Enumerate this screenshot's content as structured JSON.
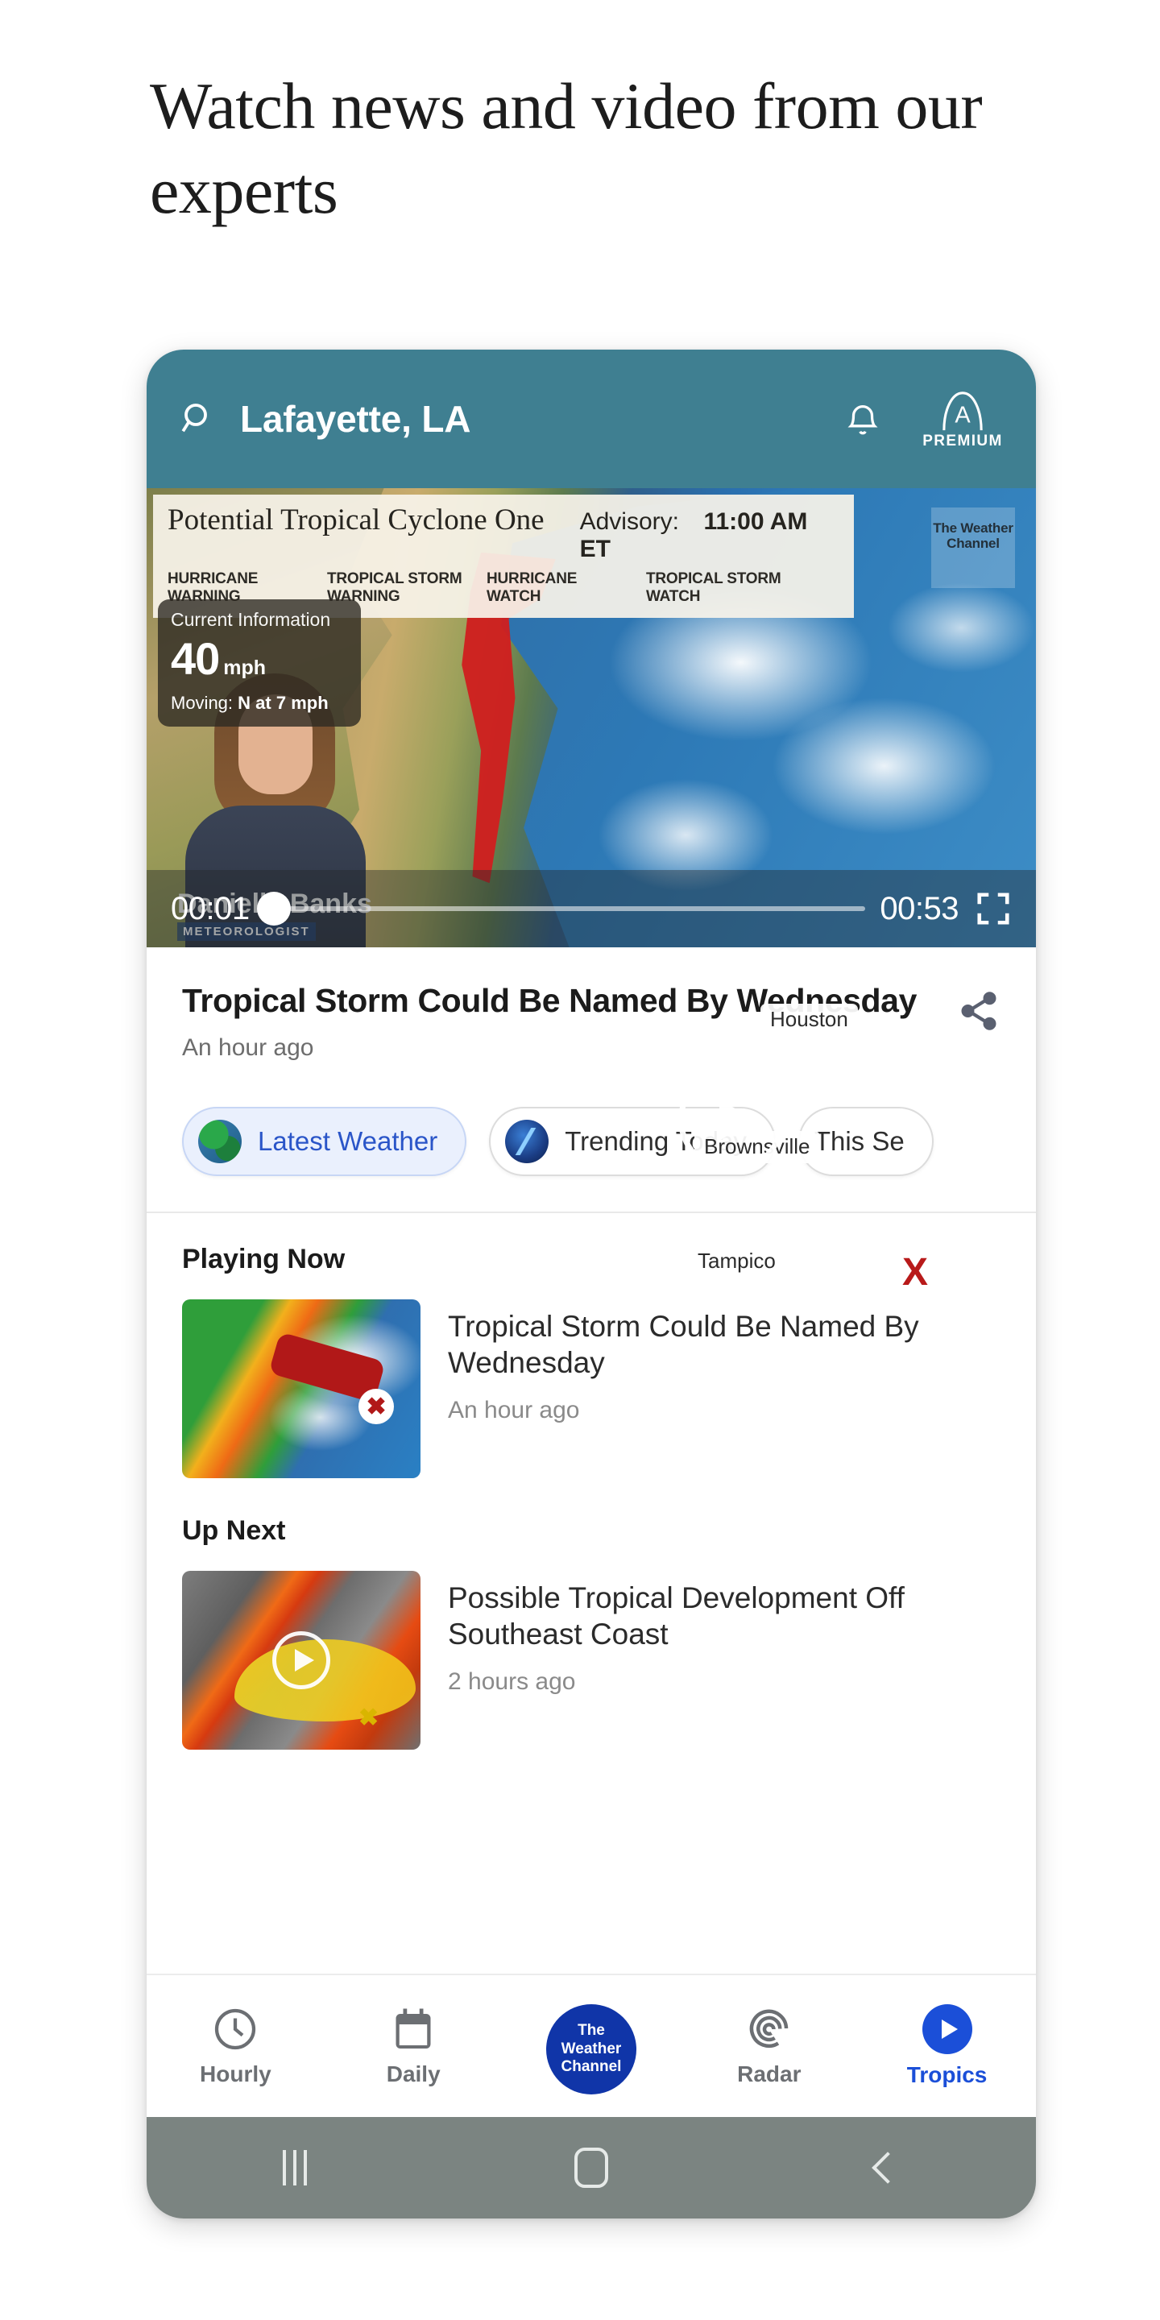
{
  "marketing": {
    "headline": "Watch news and video from our experts"
  },
  "app_header": {
    "search_icon": "search-icon",
    "location": "Lafayette, LA",
    "bell_icon": "bell-icon",
    "premium_badge_letter": "A",
    "premium_label": "PREMIUM"
  },
  "video": {
    "advisory": {
      "storm_name": "Potential Tropical Cyclone One",
      "advisory_label": "Advisory:",
      "advisory_time": "11:00 AM ET",
      "legend": [
        {
          "label": "HURRICANE WARNING",
          "color": "#8a4ff0"
        },
        {
          "label": "TROPICAL STORM WARNING",
          "color": "#c20d17"
        },
        {
          "label": "HURRICANE WATCH",
          "color": "#ef6a15"
        },
        {
          "label": "TROPICAL STORM WATCH",
          "color": "#f2c41c"
        }
      ]
    },
    "current_information": {
      "title": "Current Information",
      "wind_value": "40",
      "wind_unit": "mph",
      "moving_label": "Moving:",
      "moving_value": "N at 7 mph"
    },
    "map_labels": [
      "Houston",
      "Brownsville",
      "Tampico"
    ],
    "watermark": "The Weather Channel",
    "lower_third_name": "Danielle Banks",
    "lower_third_role": "METEOROLOGIST",
    "play_icon": "play-icon",
    "storm_marker": "X",
    "controls": {
      "elapsed": "00:01",
      "duration": "00:53",
      "progress_percent": 2,
      "fullscreen_icon": "fullscreen-icon"
    }
  },
  "article": {
    "title": "Tropical Storm Could Be Named By Wednesday",
    "time": "An hour ago",
    "share_icon": "share-icon"
  },
  "chips": [
    {
      "label": "Latest Weather",
      "icon": "globe-icon",
      "active": true
    },
    {
      "label": "Trending Today",
      "icon": "trending-icon",
      "active": false
    },
    {
      "label": "This Se",
      "icon": "",
      "active": false
    }
  ],
  "sections": {
    "playing_now": {
      "heading": "Playing Now",
      "item": {
        "title": "Tropical Storm Could Be Named By Wednesday",
        "time": "An hour ago"
      }
    },
    "up_next": {
      "heading": "Up Next",
      "item": {
        "title": "Possible Tropical Development Off Southeast Coast",
        "time": "2 hours ago"
      }
    }
  },
  "bottom_nav": [
    {
      "label": "Hourly",
      "icon": "clock-icon",
      "active": false
    },
    {
      "label": "Daily",
      "icon": "calendar-icon",
      "active": false
    },
    {
      "label": "The Weather Channel",
      "icon": "weather-channel-logo",
      "active": false
    },
    {
      "label": "Radar",
      "icon": "radar-icon",
      "active": false
    },
    {
      "label": "Tropics",
      "icon": "tropics-play-icon",
      "active": true
    }
  ],
  "system_nav": {
    "recents": "recents-button",
    "home": "home-button",
    "back": "back-button"
  },
  "colors": {
    "header_teal": "#3f7f91",
    "accent_blue": "#1b4fd8",
    "brand_navy": "#1035a8",
    "chip_active_bg": "#eaf0fd"
  }
}
